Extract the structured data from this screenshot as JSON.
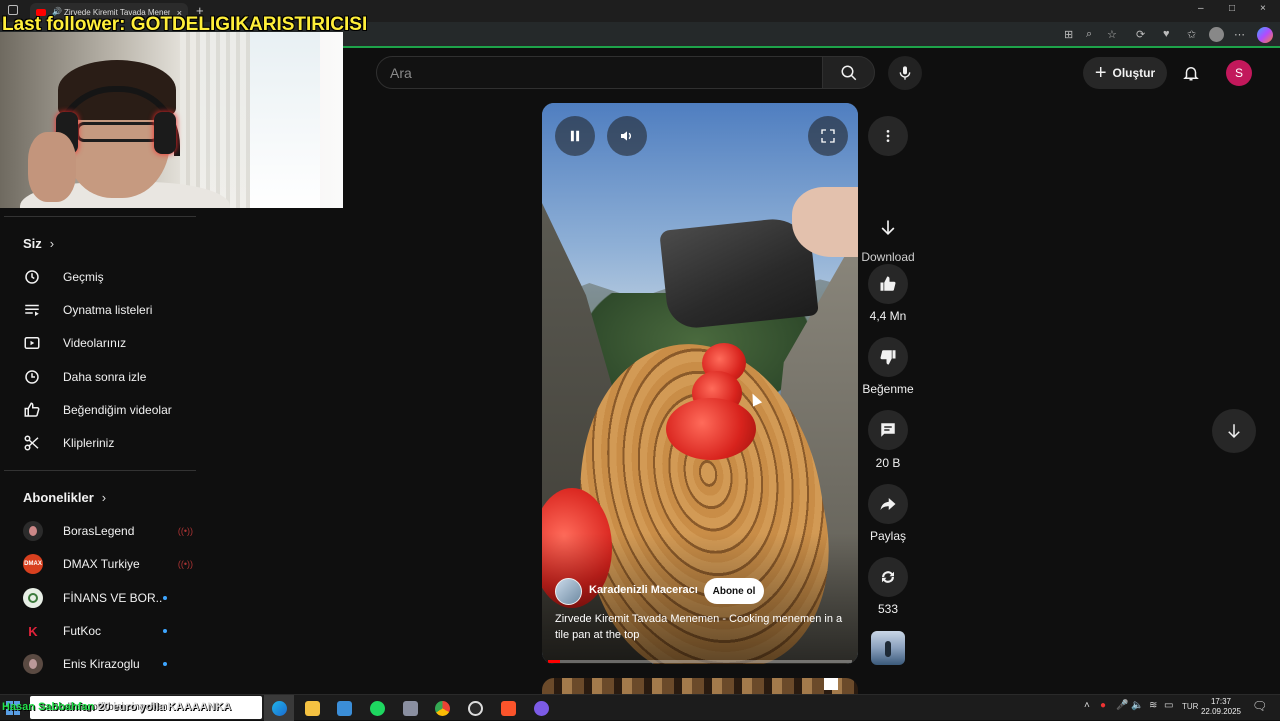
{
  "browser": {
    "tab_title": "Zirvede Kiremit Tavada Menem",
    "tab_close": "×",
    "new_tab": "+",
    "win_min": "–",
    "win_max": "□",
    "win_close": "×"
  },
  "overlay": {
    "last_follower": "Last follower: GOTDELIGIKARISTIRICISI",
    "ticker_highlight": "Hasan Sabbahfan",
    "ticker_text": " 20 euro yolla KAAAANKA"
  },
  "header": {
    "search_placeholder": "Ara",
    "create_label": "Oluştur",
    "create_plus": "+",
    "avatar_letter": "S",
    "accent_color": "#ff0000"
  },
  "sidebar": {
    "you_heading": "Siz",
    "you_items": [
      {
        "label": "Geçmiş",
        "icon": "history-icon"
      },
      {
        "label": "Oynatma listeleri",
        "icon": "playlist-icon"
      },
      {
        "label": "Videolarınız",
        "icon": "your-videos-icon"
      },
      {
        "label": "Daha sonra izle",
        "icon": "watch-later-icon"
      },
      {
        "label": "Beğendiğim videolar",
        "icon": "liked-icon"
      },
      {
        "label": "Klipleriniz",
        "icon": "clips-icon"
      }
    ],
    "subs_heading": "Abonelikler",
    "subscriptions": [
      {
        "name": "BorasLegend",
        "status": "live",
        "status_glyph": "((•))"
      },
      {
        "name": "DMAX Turkiye",
        "status": "live",
        "status_glyph": "((•))",
        "badge": "DMAX"
      },
      {
        "name": "FİNANS VE BOR...",
        "status": "new"
      },
      {
        "name": "FutKoc",
        "status": "new"
      },
      {
        "name": "Enis Kirazoglu",
        "status": "new"
      }
    ]
  },
  "short": {
    "channel_name": "Karadenizli Maceracı",
    "subscribe_label": "Abone ol",
    "title": "Zirvede Kiremit Tavada Menemen - Cooking menemen in a tile pan at the top",
    "progress": 0.04
  },
  "actions": {
    "download_label": "Download",
    "like_count": "4,4 Mn",
    "dislike_label": "Beğenme",
    "comment_count": "20 B",
    "share_label": "Paylaş",
    "remix_count": "533"
  },
  "taskbar": {
    "search_text": "Sudhangoffi bini eingeben",
    "lang": "TUR",
    "time": "17:37",
    "date": "22.09.2025"
  }
}
